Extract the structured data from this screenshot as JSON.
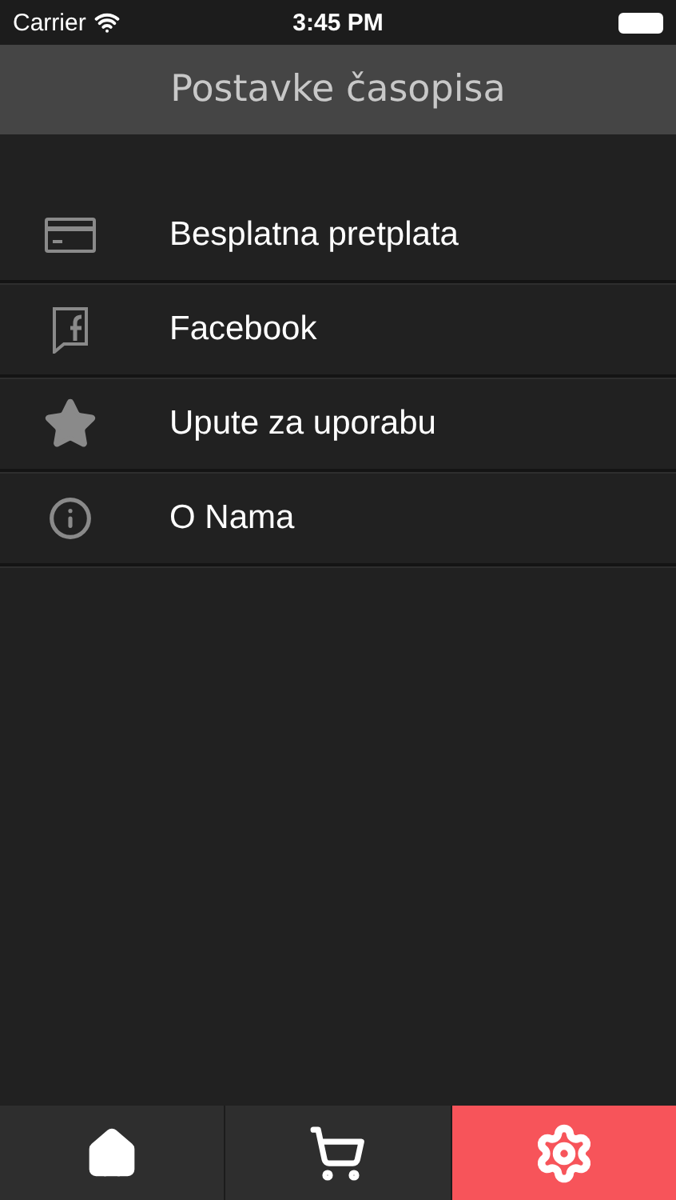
{
  "status_bar": {
    "carrier": "Carrier",
    "time": "3:45 PM"
  },
  "nav_bar": {
    "title": "Postavke časopisa"
  },
  "menu": [
    {
      "kind": "card",
      "label": "Besplatna pretplata"
    },
    {
      "kind": "facebook",
      "label": "Facebook"
    },
    {
      "kind": "star",
      "label": "Upute za uporabu"
    },
    {
      "kind": "info",
      "label": "O Nama"
    }
  ],
  "tab_bar": [
    {
      "kind": "home",
      "selected": false
    },
    {
      "kind": "cart",
      "selected": false
    },
    {
      "kind": "settings",
      "selected": true
    }
  ]
}
